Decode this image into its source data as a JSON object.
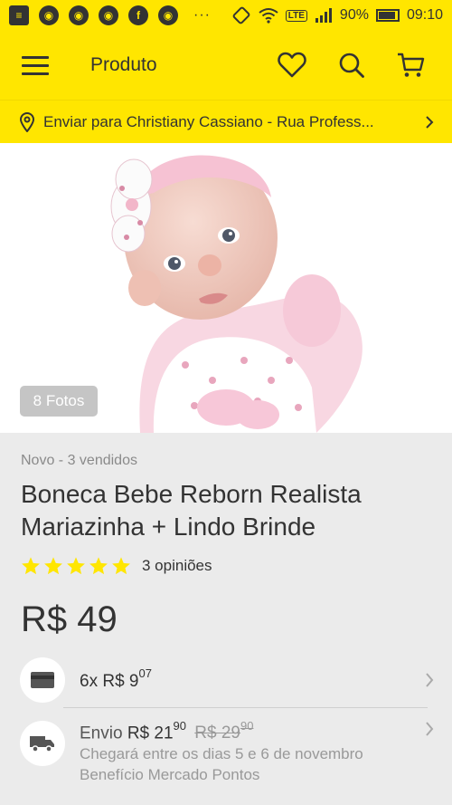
{
  "status_bar": {
    "battery": "90%",
    "time": "09:10",
    "network": "LTE",
    "dots": "···"
  },
  "header": {
    "title": "Produto"
  },
  "address": {
    "text": "Enviar para Christiany Cassiano - Rua Profess..."
  },
  "gallery": {
    "photo_count": "8 Fotos"
  },
  "product": {
    "condition": "Novo - 3 vendidos",
    "title": "Boneca Bebe Reborn Realista Mariazinha + Lindo Brinde",
    "rating": 5,
    "reviews": "3 opiniões",
    "price": "R$ 49"
  },
  "installments": {
    "prefix": "6x R$ 9",
    "cents": "07"
  },
  "shipping": {
    "label": "Envio",
    "price": "R$ 21",
    "price_cents": "90",
    "old_price": "R$ 29",
    "old_price_cents": "90",
    "arrival": "Chegará entre os dias 5 e 6 de novembro",
    "benefit": "Benefício Mercado Pontos"
  },
  "colors": {
    "brand_yellow": "#ffe600",
    "star": "#ffe600",
    "background": "#ebebeb"
  }
}
